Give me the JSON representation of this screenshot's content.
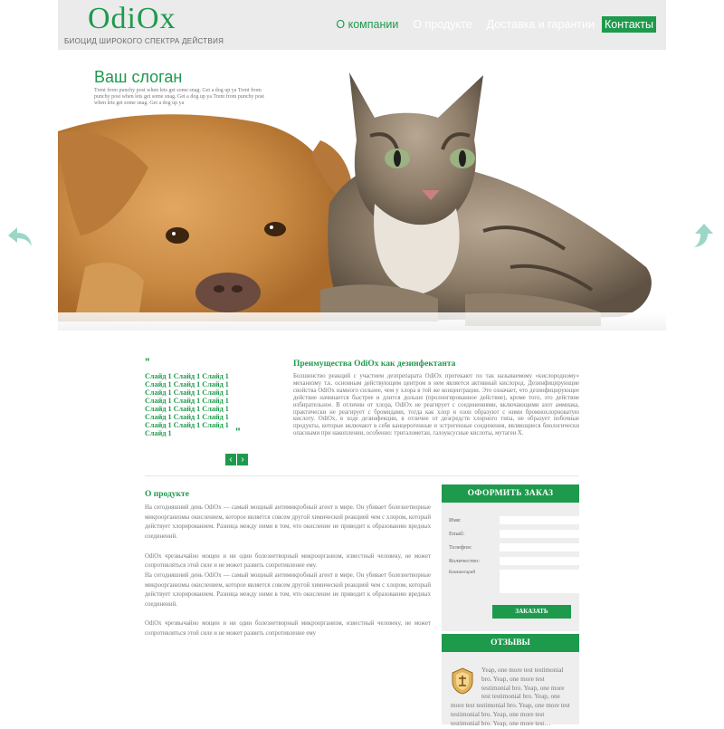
{
  "header": {
    "logo": "OdiOx",
    "tagline": "БИОЦИД ШИРОКОГО СПЕКТРА ДЕЙСТВИЯ",
    "nav": [
      {
        "label": "О компании"
      },
      {
        "label": "О продукте"
      },
      {
        "label": "Доставка и гарантии"
      },
      {
        "label": "Контакты"
      }
    ]
  },
  "hero": {
    "slogan": "Ваш слоган",
    "slogan_text": "Trent from punchy post when lets get some snag. Get a dog up ya Trent from punchy post when lets get some snag. Get a dog up ya Trent from punchy post when lets get some snag. Get a dog up ya"
  },
  "slides": {
    "quote_open": "\"",
    "text": "Слайд 1 Слайд 1 Слайд 1 Слайд 1 Слайд 1 Слайд 1 Слайд 1 Слайд 1 Слайд 1 Слайд 1 Слайд 1 Слайд 1 Слайд 1 Слайд 1 Слайд 1 Слайд 1 Слайд 1 Слайд 1 Слайд 1 Слайд 1 Слайд 1 Слайд 1",
    "quote_close": "\"",
    "prev": "‹",
    "next": "›"
  },
  "advantages": {
    "title": "Преимущества OdiOx как дезинфектанта",
    "text": "Болшинство реакций с участием дезпрепарата OdiOx протекают по так называемому «кислородному» механизму т.к. основным действующим центром в нем является активный кислород. Дезинфицирующие свойства OdiOx намного сильнее, чем у хлора в той же концентрации. Это означает, что дезинфицирующее действие начинается быстрее и длится дольше (пролонгированное действие), кроме того, это действие избирательное. В отличии от хлора, OdiOx не реагирует с соединениями, включающими азот аммиака, практически не реагирует с бромидами, тогда как хлор и озон образуют с ними бромнохлорноватую кислоту. OdiOx, в ходе дезинфекции, в отличие от дезсредств хлорного типа, не образует побочные продукты, которые включают в себя канцерогенные и эстрогенные соединения, являющиеся биологически опасными при накоплении, особенно: тригалометан, галоуксусные кислоты, мутаген X."
  },
  "about": {
    "title": "О продукте",
    "text": "На сегодняшний день OdiOx — самый мощный антимикробный агент в мире. Он убивает болезнетворные микроорганизмы окислением, которое является совсем другой химической реакцией чем с хлором, который действует хлорированием. Разница между ними в том, что окисление не приводит к образованию вредных соединений.\n\nOdiOx чрезвычайно мощен и ни один болезнетворный микроорганизм, известный человеку, не может сопротивляться этой силе и не может развить сопротивление ему.\nНа сегодняшний день OdiOx — самый мощный антимикробный агент в мире. Он убивает болезнетворные микроорганизмы окислением, которое является совсем другой химической реакцией чем с хлором, который действует хлорированием. Разница между ними в том, что окисление не приводит к образованию вредных соединений.\n\nOdiOx чрезвычайно мощен и ни один болезнетворный микроорганизм, известный человеку, не может сопротивляться этой силе и не может развить сопротивление ему"
  },
  "order": {
    "title": "ОФОРМИТЬ ЗАКАЗ",
    "fields": [
      {
        "label": "Имя:"
      },
      {
        "label": "Email:"
      },
      {
        "label": "Телефон:"
      },
      {
        "label": "Количество:"
      },
      {
        "label": "Комментарий"
      }
    ],
    "submit": "ЗАКАЗАТЬ"
  },
  "reviews": {
    "title": "ОТЗЫВЫ",
    "text": "Yeap, one more test testimonial bro. Yeap, one more test testimonial bro. Yeap, one more test testimonial bro. Yeap, one more test testimonial bro. Yeap, one more test testimonial bro. Yeap, one more test testimonial bro. Yeap, one more test…"
  },
  "colors": {
    "accent": "#1e9a4d",
    "arrows": "#9bd6c6",
    "header_bg": "#ebebeb"
  }
}
